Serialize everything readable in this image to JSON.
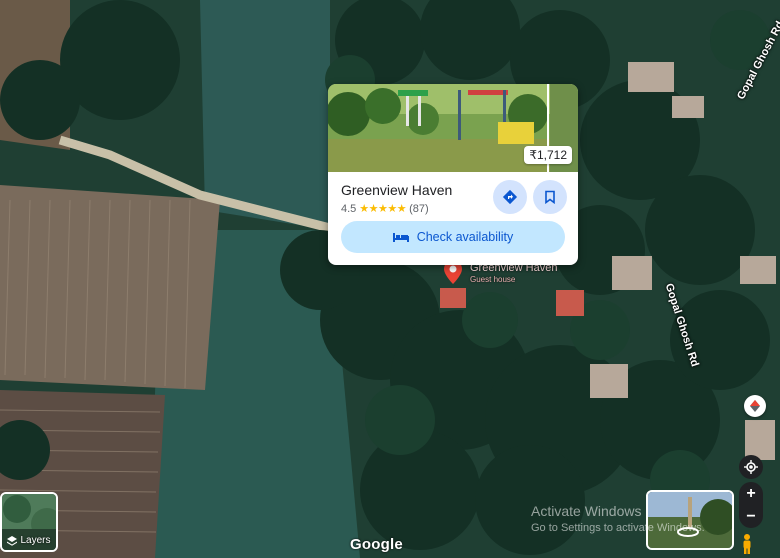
{
  "place": {
    "name": "Greenview Haven",
    "rating": "4.5",
    "stars": "★★★★★",
    "reviews": "(87)",
    "price": "₹1,712",
    "check_label": "Check availability",
    "directions_icon": "directions-icon",
    "save_icon": "bookmark-icon"
  },
  "map": {
    "roads": [
      "Gopal Ghosh Rd",
      "Gopal Ghosh Rd"
    ],
    "pin_label": "Greenview Haven",
    "pin_sub": "Guest house",
    "layers_label": "Layers",
    "brand": "Google"
  },
  "controls": {
    "zoom_in": "+",
    "zoom_out": "−",
    "icons": [
      "compass-icon",
      "my-location-icon",
      "pegman-icon",
      "layers-icon"
    ]
  },
  "watermark": {
    "line1": "Activate Windows",
    "line2": "Go to Settings to activate Windows."
  },
  "colors": {
    "accent_button": "#c2e7ff",
    "accent_text": "#0b57d0",
    "round_button": "#d3e3fd",
    "star": "#fbbc04",
    "pin": "#ea4335"
  }
}
